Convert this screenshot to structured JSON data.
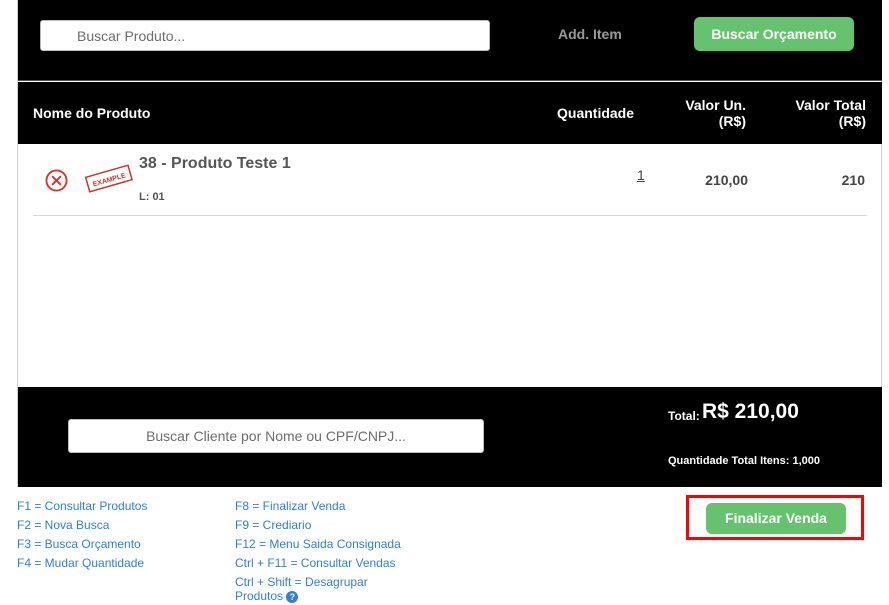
{
  "search": {
    "product_placeholder": "Buscar Produto...",
    "add_item_label": "Add. Item",
    "budget_button_label": "Buscar Orçamento"
  },
  "table": {
    "headers": {
      "name": "Nome do Produto",
      "quantity": "Quantidade",
      "unit_value_line1": "Valor Un.",
      "unit_value_line2": "(R$)",
      "total_value_line1": "Valor Total",
      "total_value_line2": "(R$)"
    },
    "rows": [
      {
        "thumb_text": "EXAMPLE",
        "name": "38 - Produto Teste 1",
        "lote": "L: 01",
        "quantity": "1",
        "unit_value": "210,00",
        "total_value": "210"
      }
    ]
  },
  "footer": {
    "client_placeholder": "Buscar Cliente por Nome ou CPF/CNPJ...",
    "total_label": "Total:",
    "total_value": "R$ 210,00",
    "total_items_label": "Quantidade Total Itens:",
    "total_items_value": "1,000"
  },
  "shortcuts": {
    "left": [
      "F1 = Consultar Produtos",
      "F2 = Nova Busca",
      "F3 = Busca Orçamento",
      "F4 = Mudar Quantidade"
    ],
    "right": [
      "F8 = Finalizar Venda",
      "F9 = Crediario",
      "F12 = Menu Saida Consignada",
      "Ctrl + F11 = Consultar Vendas",
      "Ctrl + Shift = Desagrupar Produtos"
    ]
  },
  "finalize_button_label": "Finalizar Venda",
  "icons": {
    "remove": "remove-circle-icon",
    "help": "help-icon"
  },
  "colors": {
    "accent_green": "#66c26e",
    "remove_red": "#d9342b",
    "link_blue": "#2f7fd4",
    "highlight_red": "#ff0000"
  }
}
